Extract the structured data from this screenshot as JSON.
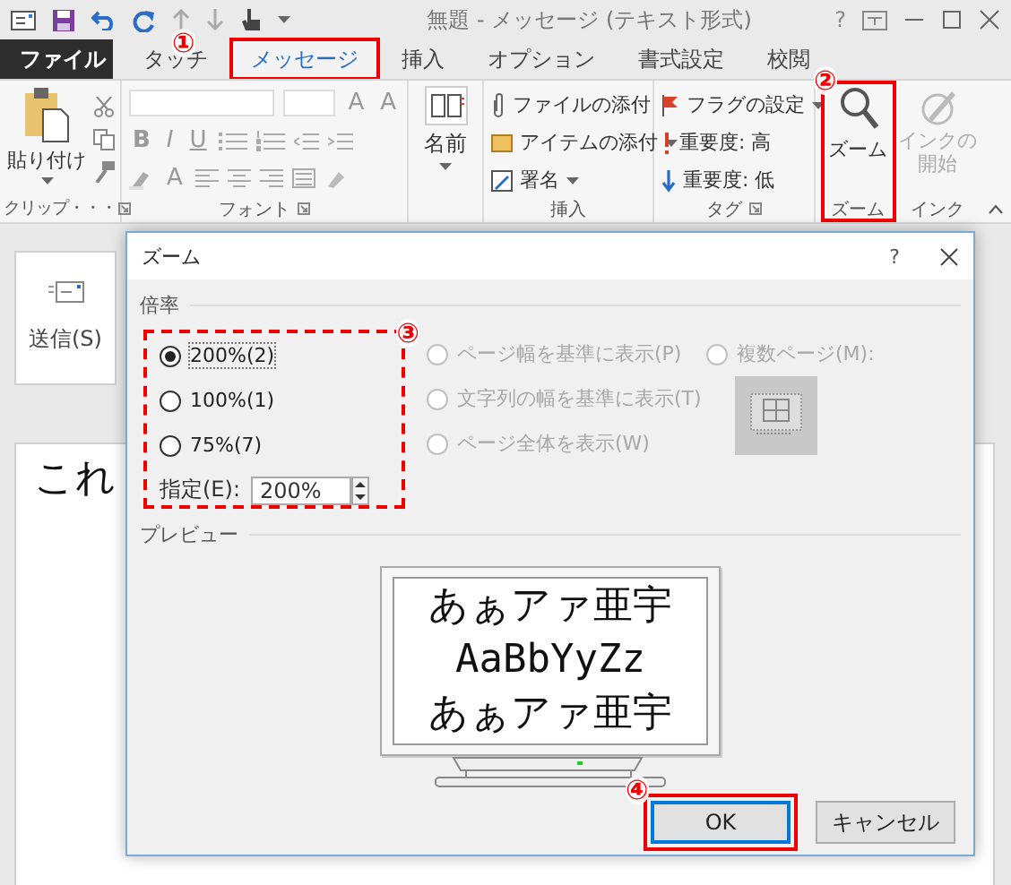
{
  "window": {
    "title": "無題 - メッセージ (テキスト形式)",
    "help": "?"
  },
  "ribbon_tabs": [
    {
      "label": "ファイル",
      "kind": "file",
      "selected": false
    },
    {
      "label": "タッチ",
      "kind": "tab",
      "selected": false
    },
    {
      "label": "メッセージ",
      "kind": "tab",
      "selected": true,
      "callout": "①"
    },
    {
      "label": "挿入",
      "kind": "tab",
      "selected": false
    },
    {
      "label": "オプション",
      "kind": "tab",
      "selected": false
    },
    {
      "label": "書式設定",
      "kind": "tab",
      "selected": false
    },
    {
      "label": "校閲",
      "kind": "tab",
      "selected": false
    }
  ],
  "clipboard": {
    "label": "クリップ・・・",
    "paste": "貼り付け"
  },
  "font": {
    "label": "フォント",
    "size_buttons": [
      "A",
      "A"
    ],
    "format_buttons": [
      "B",
      "I",
      "U"
    ],
    "color_button": "A"
  },
  "names": {
    "button": "名前"
  },
  "insert": {
    "label": "挿入",
    "items": [
      {
        "label": "ファイルの添付",
        "kind": "file",
        "dropdown": false
      },
      {
        "label": "アイテムの添付",
        "kind": "item",
        "dropdown": true
      },
      {
        "label": "署名",
        "kind": "signature",
        "dropdown": true
      }
    ]
  },
  "tags": {
    "label": "タグ",
    "items": [
      {
        "label": "フラグの設定",
        "kind": "flag",
        "dropdown": true
      },
      {
        "label": "重要度: 高",
        "kind": "high",
        "dropdown": false
      },
      {
        "label": "重要度: 低",
        "kind": "low",
        "dropdown": false
      }
    ]
  },
  "zoom": {
    "label": "ズーム",
    "button": "ズーム",
    "callout": "②"
  },
  "ink": {
    "label": "インク",
    "button": "インクの開始",
    "disabled": true
  },
  "compose": {
    "send": "送信(S)",
    "body": "これ"
  },
  "dialog": {
    "title": "ズーム",
    "help": "?",
    "zoom_group": "倍率",
    "callout": "③",
    "zoom_options": [
      {
        "label": "200%(2)",
        "selected": true
      },
      {
        "label": "100%(1)",
        "selected": false
      },
      {
        "label": "75%(7)",
        "selected": false
      }
    ],
    "custom_label": "指定(E):",
    "custom_value": "200%",
    "view_options": [
      {
        "label": "ページ幅を基準に表示(P)",
        "selected": false,
        "disabled": true
      },
      {
        "label": "文字列の幅を基準に表示(T)",
        "selected": false,
        "disabled": true
      },
      {
        "label": "ページ全体を表示(W)",
        "selected": false,
        "disabled": true
      }
    ],
    "many_pages": {
      "label": "複数ページ(M):",
      "selected": false,
      "disabled": true
    },
    "preview_label": "プレビュー",
    "preview_lines": [
      "あぁアァ亜宇",
      "AaBbYyZz",
      "あぁアァ亜宇"
    ],
    "buttons": [
      {
        "label": "OK",
        "default": true,
        "callout": "④"
      },
      {
        "label": "キャンセル",
        "default": false
      }
    ]
  }
}
